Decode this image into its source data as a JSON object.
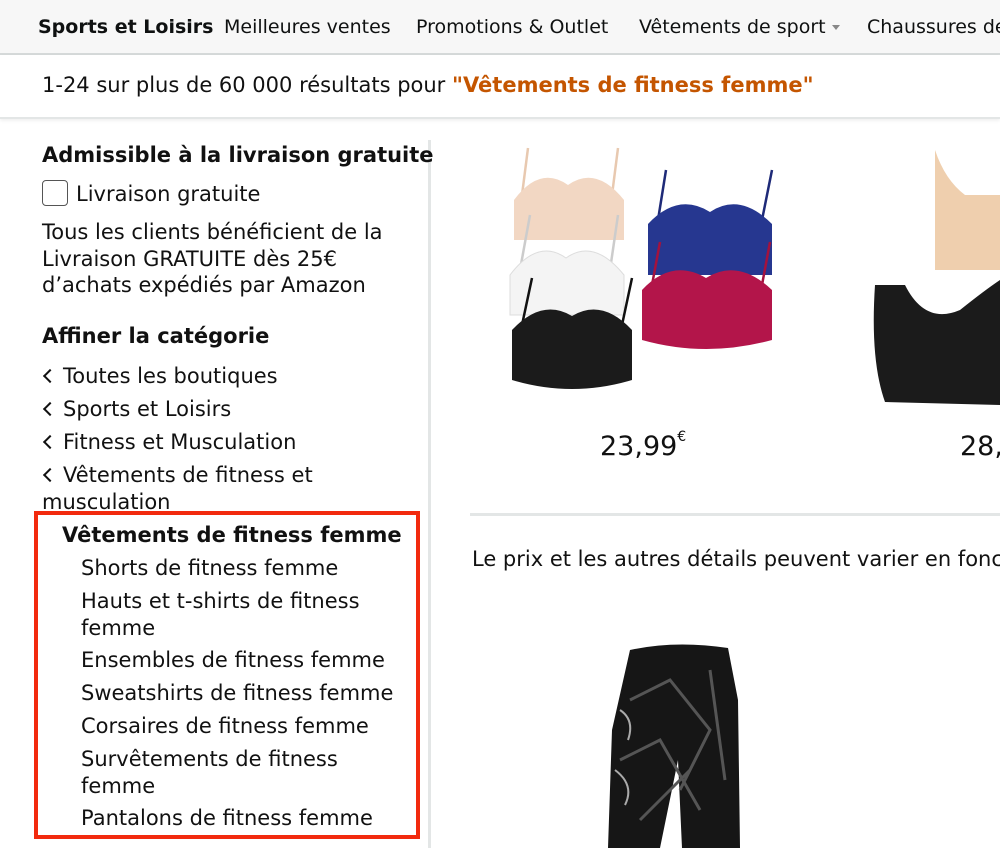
{
  "nav": {
    "items": [
      "Sports et Loisirs",
      "Meilleures ventes",
      "Promotions & Outlet",
      "Vêtements de sport",
      "Chaussures de"
    ]
  },
  "results": {
    "count_text": "1-24 sur plus de 60 000 résultats pour ",
    "query": "\"Vêtements de fitness femme\""
  },
  "sidebar": {
    "shipping_heading": "Admissible à la livraison gratuite",
    "free_shipping_label": "Livraison gratuite",
    "free_shipping_note": "Tous les clients bénéficient de la Livraison GRATUITE dès 25€ d’achats expédiés par Amazon",
    "category_heading": "Affiner la catégorie",
    "back_links": [
      "Toutes les boutiques",
      "Sports et Loisirs",
      "Fitness et Musculation",
      "Vêtements de fitness et musculation"
    ],
    "current_category": "Vêtements de fitness femme",
    "subcategories": [
      "Shorts de fitness femme",
      "Hauts et t-shirts de fitness femme",
      "Ensembles de fitness femme",
      "Sweatshirts de fitness femme",
      "Corsaires de fitness femme",
      "Survêtements de fitness femme",
      "Pantalons de fitness femme"
    ]
  },
  "products": {
    "p1_price": "23,99",
    "p1_currency": "€",
    "p2_price": "28,",
    "disclaimer": "Le prix et les autres détails peuvent varier en fonct"
  },
  "colors": {
    "accent_query": "#c45500",
    "highlight_border": "#f22a0e"
  }
}
